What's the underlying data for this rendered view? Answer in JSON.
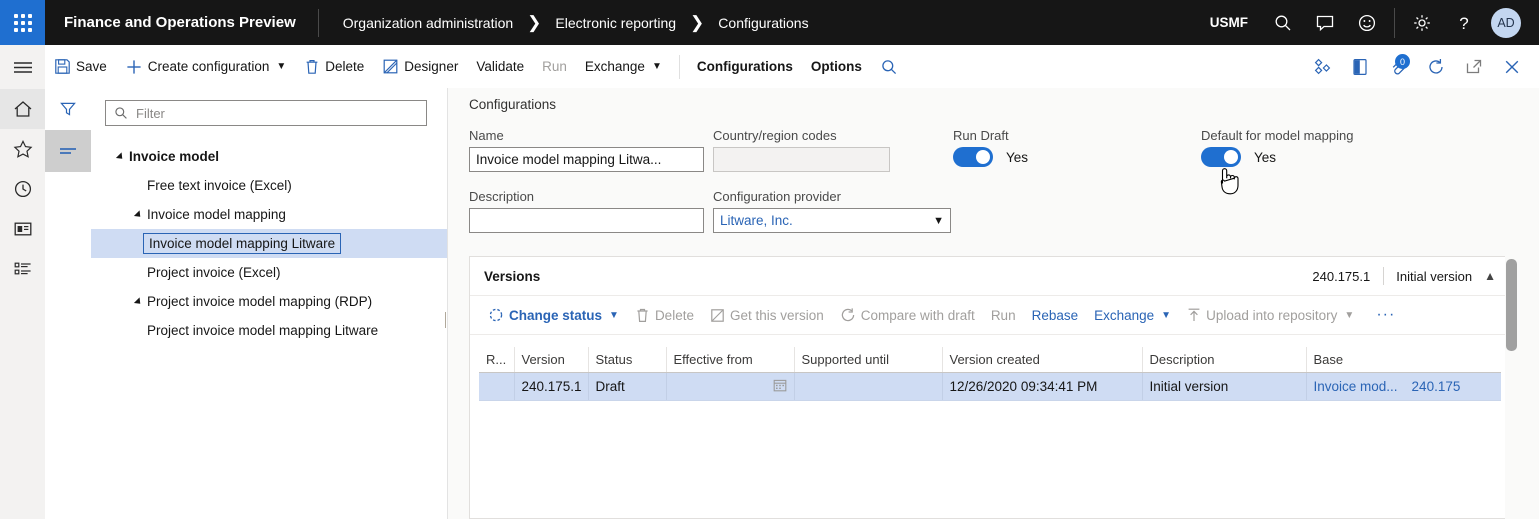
{
  "topbar": {
    "waffle_icon": "waffle-grid-icon",
    "app_title": "Finance and Operations Preview",
    "breadcrumbs": [
      "Organization administration",
      "Electronic reporting",
      "Configurations"
    ],
    "company": "USMF",
    "icons": [
      "search-icon",
      "message-icon",
      "feedback-smiley-icon",
      "settings-gear-icon",
      "help-question-icon"
    ],
    "avatar_initials": "AD"
  },
  "nav_rail": {
    "items": [
      "hamburger-menu-icon",
      "home-icon",
      "favorites-star-icon",
      "recent-clock-icon",
      "workspaces-icon",
      "modules-icon"
    ]
  },
  "panel_rail": {
    "items": [
      "filter-icon",
      "list-lines-icon"
    ]
  },
  "action_pane": {
    "buttons": [
      {
        "label": "Save",
        "icon": "save-disk-icon",
        "disabled": false,
        "caret": false,
        "bold": false
      },
      {
        "label": "Create configuration",
        "icon": "plus-icon",
        "disabled": false,
        "caret": true,
        "bold": false
      },
      {
        "label": "Delete",
        "icon": "trash-icon",
        "disabled": false,
        "caret": false,
        "bold": false
      },
      {
        "label": "Designer",
        "icon": "designer-icon",
        "disabled": false,
        "caret": false,
        "bold": false
      },
      {
        "label": "Validate",
        "icon": "",
        "disabled": false,
        "caret": false,
        "bold": false
      },
      {
        "label": "Run",
        "icon": "",
        "disabled": true,
        "caret": false,
        "bold": false
      },
      {
        "label": "Exchange",
        "icon": "",
        "disabled": false,
        "caret": true,
        "bold": false
      }
    ],
    "tabs": [
      {
        "label": "Configurations",
        "bold": true
      },
      {
        "label": "Options",
        "bold": true
      }
    ],
    "search_icon": "search-icon",
    "right_icons": [
      {
        "name": "share-diamond-icon",
        "badge": ""
      },
      {
        "name": "office-app-icon",
        "badge": ""
      },
      {
        "name": "attachments-icon",
        "badge": "0"
      },
      {
        "name": "refresh-icon",
        "badge": ""
      },
      {
        "name": "popout-icon",
        "badge": ""
      },
      {
        "name": "close-icon",
        "badge": ""
      }
    ]
  },
  "tree_panel": {
    "filter_placeholder": "Filter",
    "filter_value": "",
    "nodes": [
      {
        "label": "Invoice model",
        "indent": 0,
        "expander": true,
        "bold": true,
        "selected": false
      },
      {
        "label": "Free text invoice (Excel)",
        "indent": 1,
        "expander": false,
        "bold": false,
        "selected": false
      },
      {
        "label": "Invoice model mapping",
        "indent": 1,
        "expander": true,
        "bold": false,
        "selected": false
      },
      {
        "label": "Invoice model mapping Litware",
        "indent": 2,
        "expander": false,
        "bold": false,
        "selected": true
      },
      {
        "label": "Project invoice (Excel)",
        "indent": 1,
        "expander": false,
        "bold": false,
        "selected": false
      },
      {
        "label": "Project invoice model mapping (RDP)",
        "indent": 1,
        "expander": true,
        "bold": false,
        "selected": false
      },
      {
        "label": "Project invoice model mapping Litware",
        "indent": 2,
        "expander": false,
        "bold": false,
        "selected": false
      }
    ]
  },
  "form": {
    "section_title": "Configurations",
    "name_label": "Name",
    "name_value": "Invoice model mapping Litwa...",
    "country_label": "Country/region codes",
    "country_value": "",
    "description_label": "Description",
    "description_value": "",
    "provider_label": "Configuration provider",
    "provider_value": "Litware, Inc.",
    "run_draft_label": "Run Draft",
    "run_draft_state": "Yes",
    "default_mapping_label": "Default for model mapping",
    "default_mapping_state": "Yes"
  },
  "versions": {
    "title": "Versions",
    "summary_version": "240.175.1",
    "summary_description": "Initial version",
    "collapse_icon": "chevron-up-icon",
    "toolbar": [
      {
        "label": "Change status",
        "icon": "change-status-icon",
        "disabled": false,
        "caret": true,
        "bold": true
      },
      {
        "label": "Delete",
        "icon": "trash-icon",
        "disabled": true,
        "caret": false,
        "bold": false
      },
      {
        "label": "Get this version",
        "icon": "get-version-icon",
        "disabled": true,
        "caret": false,
        "bold": false
      },
      {
        "label": "Compare with draft",
        "icon": "compare-icon",
        "disabled": true,
        "caret": false,
        "bold": false
      },
      {
        "label": "Run",
        "icon": "",
        "disabled": true,
        "caret": false,
        "bold": false
      },
      {
        "label": "Rebase",
        "icon": "",
        "disabled": false,
        "caret": false,
        "bold": false
      },
      {
        "label": "Exchange",
        "icon": "",
        "disabled": false,
        "caret": true,
        "bold": false
      },
      {
        "label": "Upload into repository",
        "icon": "upload-icon",
        "disabled": true,
        "caret": true,
        "bold": false
      }
    ],
    "overflow_label": "···",
    "grid": {
      "columns": [
        "R...",
        "Version",
        "Status",
        "Effective from",
        "Supported until",
        "Version created",
        "Description",
        "Base"
      ],
      "rows": [
        {
          "r": "",
          "version": "240.175.1",
          "status": "Draft",
          "effective_from": "",
          "supported_until": "",
          "version_created": "12/26/2020 09:34:41 PM",
          "description": "Initial version",
          "base_name": "Invoice mod...",
          "base_version": "240.175"
        }
      ]
    }
  },
  "colors": {
    "brand_blue": "#1f6fd0",
    "link_blue": "#2a64b5",
    "topbar_bg": "#161616",
    "row_selected": "#cfdcf3",
    "disabled_text": "#a19f9d"
  }
}
